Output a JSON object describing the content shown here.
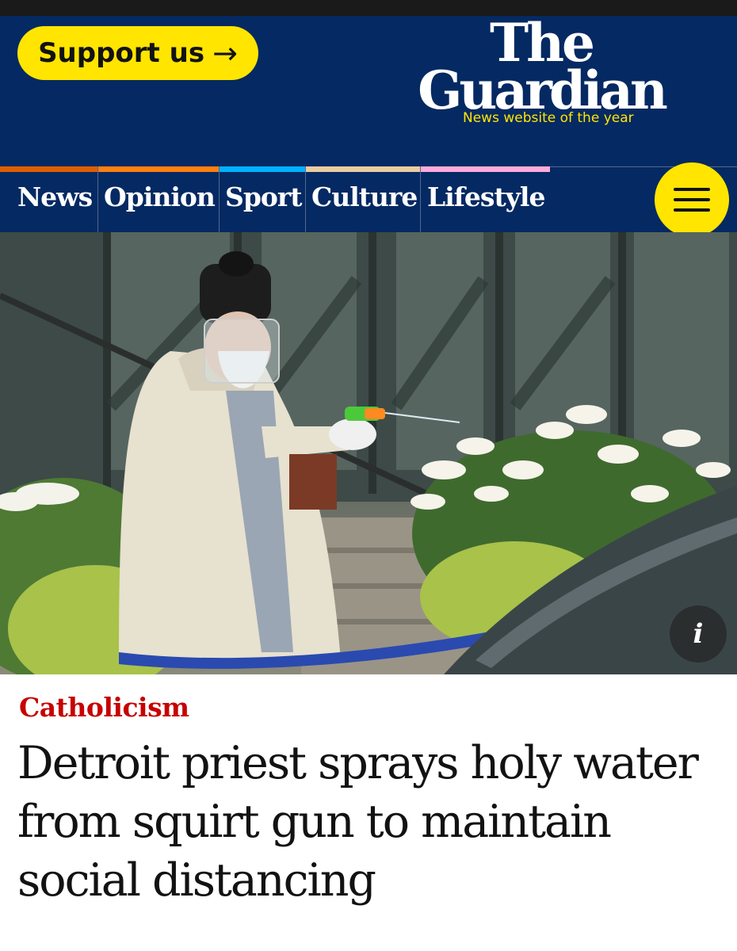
{
  "header": {
    "support_label": "Support us",
    "logo_line1": "The",
    "logo_line2": "Guardian",
    "tagline": "News website of the year"
  },
  "nav": {
    "items": [
      {
        "label": "News",
        "accent": "#e05e00"
      },
      {
        "label": "Opinion",
        "accent": "#ff7f0f"
      },
      {
        "label": "Sport",
        "accent": "#00b2ff"
      },
      {
        "label": "Culture",
        "accent": "#eacca0"
      },
      {
        "label": "Lifestyle",
        "accent": "#ffabdb"
      }
    ],
    "menu_icon": "hamburger-icon"
  },
  "article": {
    "image_info_icon": "info-icon",
    "info_label": "i",
    "kicker": "Catholicism",
    "headline": "Detroit priest sprays holy water from squirt gun to maintain social distancing"
  },
  "colors": {
    "brand_blue": "#052962",
    "support_yellow": "#ffe500",
    "kicker_red": "#c70000"
  }
}
